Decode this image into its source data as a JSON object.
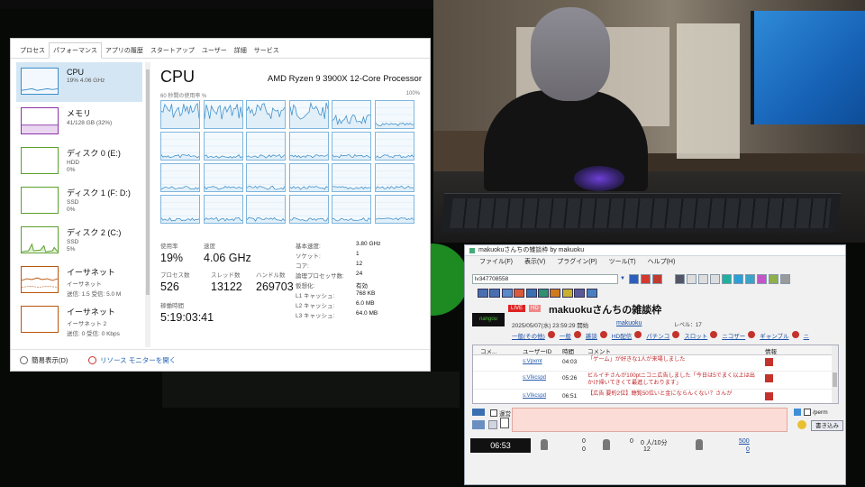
{
  "taskmanager": {
    "tabs": [
      "プロセス",
      "パフォーマンス",
      "アプリの履歴",
      "スタートアップ",
      "ユーザー",
      "詳細",
      "サービス"
    ],
    "active_tab": 1,
    "sidebar": [
      {
        "name": "CPU",
        "line1": "19% 4.06 GHz",
        "line2": "",
        "kind": "cpu"
      },
      {
        "name": "メモリ",
        "line1": "41/128 GB (32%)",
        "line2": "",
        "kind": "mem"
      },
      {
        "name": "ディスク 0 (E:)",
        "line1": "HDD",
        "line2": "0%",
        "kind": "disk"
      },
      {
        "name": "ディスク 1 (F: D:)",
        "line1": "SSD",
        "line2": "0%",
        "kind": "disk"
      },
      {
        "name": "ディスク 2 (C:)",
        "line1": "SSD",
        "line2": "5%",
        "kind": "disk"
      },
      {
        "name": "イーサネット",
        "line1": "イーサネット",
        "line2": "送信: 1.5  受信: 5.0 M",
        "kind": "net"
      },
      {
        "name": "イーサネット",
        "line1": "イーサネット 2",
        "line2": "送信: 0  受信: 0 Kbps",
        "kind": "net"
      }
    ],
    "main": {
      "title": "CPU",
      "model": "AMD Ryzen 9 3900X 12-Core Processor",
      "graph_label_left": "60 秒間の使用率 %",
      "graph_label_right": "100%",
      "stats": {
        "usage_label": "使用率",
        "usage": "19%",
        "speed_label": "速度",
        "speed": "4.06 GHz",
        "process_label": "プロセス数",
        "processes": "526",
        "thread_label": "スレッド数",
        "threads": "13122",
        "handle_label": "ハンドル数",
        "handles": "269703",
        "uptime_label": "稼働時間",
        "uptime": "5:19:03:41"
      },
      "specs": [
        {
          "k": "基本速度:",
          "v": "3.80 GHz"
        },
        {
          "k": "ソケット:",
          "v": "1"
        },
        {
          "k": "コア:",
          "v": "12"
        },
        {
          "k": "論理プロセッサ数:",
          "v": "24"
        },
        {
          "k": "仮想化:",
          "v": "有効"
        },
        {
          "k": "L1 キャッシュ:",
          "v": "768 KB"
        },
        {
          "k": "L2 キャッシュ:",
          "v": "6.0 MB"
        },
        {
          "k": "L3 キャッシュ:",
          "v": "64.0 MB"
        }
      ]
    },
    "footer": {
      "simple_view": "簡易表示(D)",
      "resource_monitor": "リソース モニターを開く"
    }
  },
  "viewer": {
    "title": "makuokuさんちの雑談枠 by makuoku",
    "menus": [
      "ファイル(F)",
      "表示(V)",
      "プラグイン(P)",
      "ツール(T)",
      "ヘルプ(H)"
    ],
    "live_id": "lv347708558",
    "live_badge": "LIVE",
    "hd_badge": "HD",
    "broadcast_title": "makuokuさんちの雑談枠",
    "thumbnail_text": "nangou",
    "start_info": "2025/05/07(水) 23:59:29 開始",
    "owner": "makuoku",
    "level": "レベル：17",
    "tags": [
      "一般(その他)",
      "一般",
      "雑談",
      "HD配信",
      "パチンコ",
      "スロット",
      "ニコザー",
      "ギャンブル",
      "ニ"
    ],
    "columns": {
      "no": "コメ...",
      "uid": "ユーザーID",
      "time": "時間",
      "comment": "コメント",
      "info": "情報"
    },
    "comments": [
      {
        "uid": "s:Vpxmt",
        "time": "04:03",
        "text": "「ゲーム」が好きな1人が来場しました"
      },
      {
        "uid": "s:VIkcspd",
        "time": "05:26",
        "text": "ビルイチさんが100ptニコニ広告しました「今日は5でまく以上は出かけ帰いてきくて最進しております」"
      },
      {
        "uid": "s:VIkcspd",
        "time": "06:51",
        "text": "【広告 要約2位】聴覧50位いと金にならんくない？さんが"
      }
    ],
    "anon_label": "運営",
    "perm_label": "/perm",
    "send_label": "書き込み",
    "clock": "06:53",
    "status": {
      "a": "0",
      "b": "0",
      "c": "0",
      "visitors": "0 人/10分",
      "d": "12",
      "e": "500",
      "f": "0"
    }
  }
}
